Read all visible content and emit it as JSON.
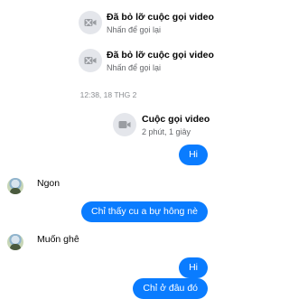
{
  "messages": {
    "missed_call_1": {
      "title": "Đã bỏ lỡ cuộc gọi video",
      "subtitle": "Nhấn để gọi lại",
      "icon": "video-camera-off-icon"
    },
    "missed_call_2": {
      "title": "Đã bỏ lỡ cuộc gọi video",
      "subtitle": "Nhấn để gọi lại",
      "icon": "video-camera-off-icon"
    },
    "timestamp": "12:38, 18 THG 2",
    "video_call": {
      "title": "Cuộc gọi video",
      "subtitle": "2 phút, 1 giây",
      "icon": "video-camera-icon"
    },
    "out_1": "Hi",
    "in_1": "Ngon",
    "out_2": "Chỉ thấy cu a bự hông nè",
    "in_2": "Muốn ghê",
    "out_3": "Hi",
    "out_4": "Chỉ ở đâu đó"
  },
  "colors": {
    "outgoing_bubble": "#0a7cff",
    "call_icon_bg": "#e4e6eb",
    "secondary_text": "#65676b"
  }
}
